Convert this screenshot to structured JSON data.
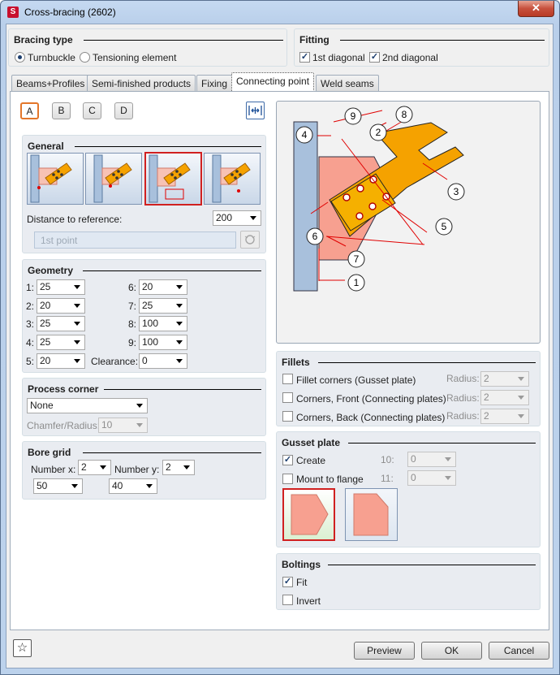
{
  "window": {
    "title": "Cross-bracing (2602)",
    "close": "✕"
  },
  "bracing_type": {
    "title": "Bracing type",
    "options": [
      "Turnbuckle",
      "Tensioning element"
    ],
    "selected": "Turnbuckle"
  },
  "fitting": {
    "title": "Fitting",
    "first_diagonal": "1st diagonal",
    "second_diagonal": "2nd diagonal",
    "first_checked": true,
    "second_checked": true
  },
  "tabs": [
    "Beams+Profiles",
    "Semi-finished products",
    "Fixing",
    "Connecting point",
    "Weld seams"
  ],
  "active_tab": "Connecting point",
  "variants": [
    "A",
    "B",
    "C",
    "D"
  ],
  "selected_variant": "A",
  "general": {
    "title": "General",
    "distance_label": "Distance to reference:",
    "distance_value": "200",
    "first_point_placeholder": "1st point",
    "selected_tile": 3
  },
  "geometry": {
    "title": "Geometry",
    "rows": [
      {
        "l": "1:",
        "v": "25",
        "r": "6:",
        "rv": "20"
      },
      {
        "l": "2:",
        "v": "20",
        "r": "7:",
        "rv": "25"
      },
      {
        "l": "3:",
        "v": "25",
        "r": "8:",
        "rv": "100"
      },
      {
        "l": "4:",
        "v": "25",
        "r": "9:",
        "rv": "100"
      },
      {
        "l": "5:",
        "v": "20",
        "r": "Clearance:",
        "rv": "0"
      }
    ]
  },
  "process_corner": {
    "title": "Process corner",
    "value": "None",
    "chamfer_label": "Chamfer/Radius:",
    "chamfer_value": "10"
  },
  "bore_grid": {
    "title": "Bore grid",
    "number_x_label": "Number x:",
    "number_x": "2",
    "number_y_label": "Number y:",
    "number_y": "2",
    "spacing_x": "50",
    "spacing_y": "40"
  },
  "diagram": {
    "labels": [
      "1",
      "2",
      "3",
      "4",
      "5",
      "6",
      "7",
      "8",
      "9"
    ]
  },
  "fillets": {
    "title": "Fillets",
    "rows": [
      {
        "label": "Fillet corners (Gusset plate)",
        "radius_label": "Radius:",
        "radius": "2"
      },
      {
        "label": "Corners, Front (Connecting plates)",
        "radius_label": "Radius:",
        "radius": "2"
      },
      {
        "label": "Corners, Back (Connecting plates)",
        "radius_label": "Radius:",
        "radius": "2"
      }
    ]
  },
  "gusset": {
    "title": "Gusset plate",
    "create": "Create",
    "create_checked": true,
    "mount": "Mount to flange",
    "mount_checked": false,
    "f10_label": "10:",
    "f10": "0",
    "f11_label": "11:",
    "f11": "0"
  },
  "boltings": {
    "title": "Boltings",
    "fit": "Fit",
    "fit_checked": true,
    "invert": "Invert",
    "invert_checked": false
  },
  "buttons": {
    "preview": "Preview",
    "ok": "OK",
    "cancel": "Cancel"
  },
  "colors": {
    "accent_orange": "#f5a200",
    "gusset_salmon": "#f7a090",
    "column_blue": "#a8c0dc",
    "dimension_red": "#e00000",
    "selection_red": "#d02020"
  }
}
